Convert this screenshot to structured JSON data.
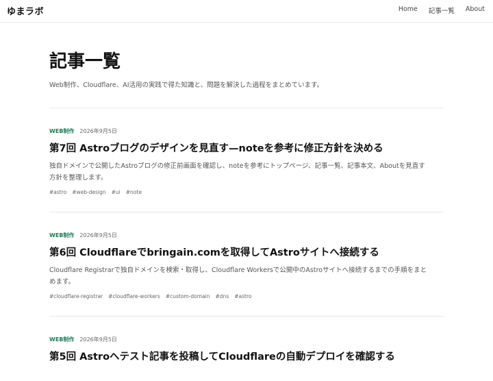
{
  "site": {
    "title": "ゆまラボ"
  },
  "nav": {
    "items": [
      {
        "label": "Home"
      },
      {
        "label": "記事一覧"
      },
      {
        "label": "About"
      }
    ]
  },
  "page": {
    "title": "記事一覧",
    "description": "Web制作、Cloudflare、AI活用の実践で得た知識と、問題を解決した過程をまとめています。"
  },
  "posts": [
    {
      "category": "WEB制作",
      "date": "2026年9月5日",
      "title": "第7回 Astroブログのデザインを見直す—noteを参考に修正方針を決める",
      "excerpt": "独自ドメインで公開したAstroブログの修正前画面を確認し、noteを参考にトップページ、記事一覧、記事本文、Aboutを見直す方針を整理します。",
      "tags": [
        "#astro",
        "#web-design",
        "#ui",
        "#note"
      ]
    },
    {
      "category": "WEB制作",
      "date": "2026年9月5日",
      "title": "第6回 Cloudflareでbringain.comを取得してAstroサイトへ接続する",
      "excerpt": "Cloudflare Registrarで独自ドメインを検索・取得し、Cloudflare Workersで公開中のAstroサイトへ接続するまでの手順をまとめます。",
      "tags": [
        "#cloudflare-registrar",
        "#cloudflare-workers",
        "#custom-domain",
        "#dns",
        "#astro"
      ]
    },
    {
      "category": "WEB制作",
      "date": "2026年9月5日",
      "title": "第5回 Astroへテスト記事を投稿してCloudflareの自動デプロイを確認する",
      "excerpt": "",
      "tags": []
    }
  ]
}
